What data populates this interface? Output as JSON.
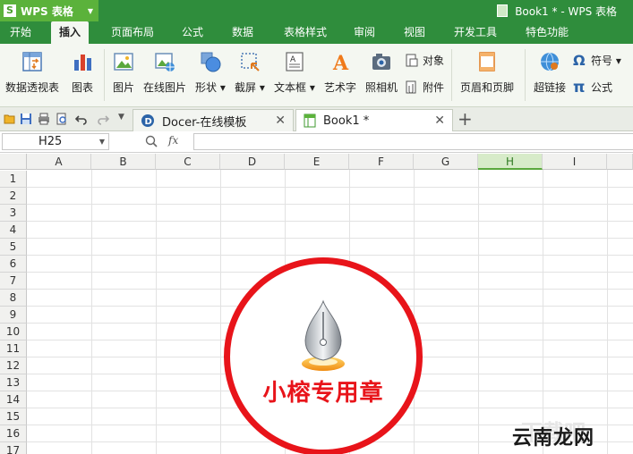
{
  "app": {
    "name": "WPS 表格",
    "window_title": "Book1 * - WPS 表格"
  },
  "menu": {
    "tabs": [
      "开始",
      "插入",
      "页面布局",
      "公式",
      "数据",
      "表格样式",
      "审阅",
      "视图",
      "开发工具",
      "特色功能"
    ],
    "active_tab": "插入"
  },
  "ribbon": {
    "pivot_table": "数据透视表",
    "chart": "图表",
    "picture": "图片",
    "online_picture": "在线图片",
    "shapes": "形状",
    "screenshot": "截屏",
    "textbox": "文本框",
    "wordart": "艺术字",
    "camera": "照相机",
    "object": "对象",
    "attachment": "附件",
    "header_footer": "页眉和页脚",
    "hyperlink": "超链接",
    "symbol": "符号",
    "formula": "公式"
  },
  "doc_tabs": [
    {
      "label": "Docer-在线模板",
      "active": false
    },
    {
      "label": "Book1 *",
      "active": true
    }
  ],
  "formula_bar": {
    "cell_ref": "H25",
    "fx_label": "fx",
    "value": ""
  },
  "sheet": {
    "columns": [
      "A",
      "B",
      "C",
      "D",
      "E",
      "F",
      "G",
      "H",
      "I"
    ],
    "selected_column": "H",
    "rows": [
      "1",
      "2",
      "3",
      "4",
      "5",
      "6",
      "7",
      "8",
      "9",
      "10",
      "11",
      "12",
      "13",
      "14",
      "15",
      "16",
      "17"
    ]
  },
  "stamp": {
    "text": "小榕专用章",
    "color": "#e8141a"
  },
  "watermark": {
    "text": "云南龙网"
  },
  "colors": {
    "title_bar": "#2f8d3c",
    "app_button": "#5bb23b",
    "selected_header": "#d7ebc9"
  }
}
